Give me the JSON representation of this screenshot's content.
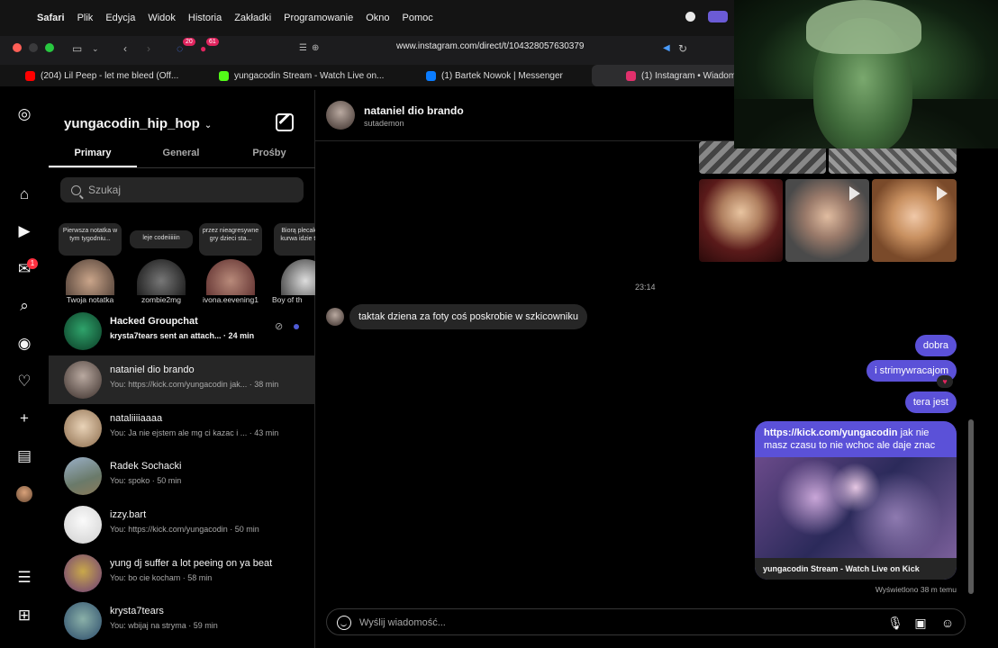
{
  "menubar": {
    "items": [
      "Safari",
      "Plik",
      "Edycja",
      "Widok",
      "Historia",
      "Zakładki",
      "Programowanie",
      "Okno",
      "Pomoc"
    ]
  },
  "toolbar": {
    "url": "www.instagram.com/direct/t/104328057630379",
    "badge_1": "20",
    "badge_2": "61"
  },
  "tabs": [
    {
      "label": "(204) Lil Peep - let me bleed (Off...",
      "color": "#ff0000"
    },
    {
      "label": "yungacodin Stream - Watch Live on...",
      "color": "#53fc18"
    },
    {
      "label": "(1) Bartek Nowok | Messenger",
      "color": "#0a7cff"
    },
    {
      "label": "(1) Instagram • Wiadom",
      "color": "#e1306c"
    }
  ],
  "sidebar": {
    "notification_count": "1",
    "account_name": "yungacodin_hip_hop",
    "folder_tabs": [
      "Primary",
      "General",
      "Prośby"
    ],
    "search_placeholder": "Szukaj"
  },
  "notes": [
    {
      "text": "Pierwsza notatka w tym tygodniu...",
      "name": "Twoja notatka"
    },
    {
      "text": "leje codeiiiiiin",
      "name": "zombie2mg"
    },
    {
      "text": "przez nieagresywne gry dzieci sta...",
      "name": "ivona.eevening1"
    },
    {
      "text": "Biorą plecak idą i kurwa idzie to w...",
      "name": "Boy of th"
    }
  ],
  "conversations": [
    {
      "name": "Hacked Groupchat",
      "preview": "krysta7tears sent an attach... · 24 min",
      "unread": true
    },
    {
      "name": "nataniel dio brando",
      "preview": "You: https://kick.com/yungacodin jak... · 38 min",
      "unread": false
    },
    {
      "name": "nataliiiiaaaa",
      "preview": "You: Ja nie ejstem ale mg ci kazac i ... · 43 min",
      "unread": false
    },
    {
      "name": "Radek Sochacki",
      "preview": "You: spoko · 50 min",
      "unread": false
    },
    {
      "name": "izzy.bart",
      "preview": "You: https://kick.com/yungacodin · 50 min",
      "unread": false
    },
    {
      "name": "yung dj suffer a lot peeing on ya beat",
      "preview": "You: bo cie kocham · 58 min",
      "unread": false
    },
    {
      "name": "krysta7tears",
      "preview": "You: wbijaj na stryma · 59 min",
      "unread": false
    }
  ],
  "chat": {
    "name": "nataniel dio brando",
    "username": "sutademon",
    "timestamp": "23:14",
    "incoming": "taktak dziena za foty coś poskrobie w szkicowniku",
    "outgoing": [
      "dobra",
      "i strimywracajom",
      "tera jest"
    ],
    "link_url": "https://kick.com/yungacodin",
    "link_text": " jak nie masz czasu to nie wchoc ale daje znac",
    "link_caption": "yungacodin Stream - Watch Live on Kick",
    "seen": "Wyświetlono 38 m temu",
    "composer_placeholder": "Wyślij wiadomość..."
  },
  "colors": {
    "accent": "#5b51d8",
    "background": "#000000",
    "surface": "#262626"
  }
}
